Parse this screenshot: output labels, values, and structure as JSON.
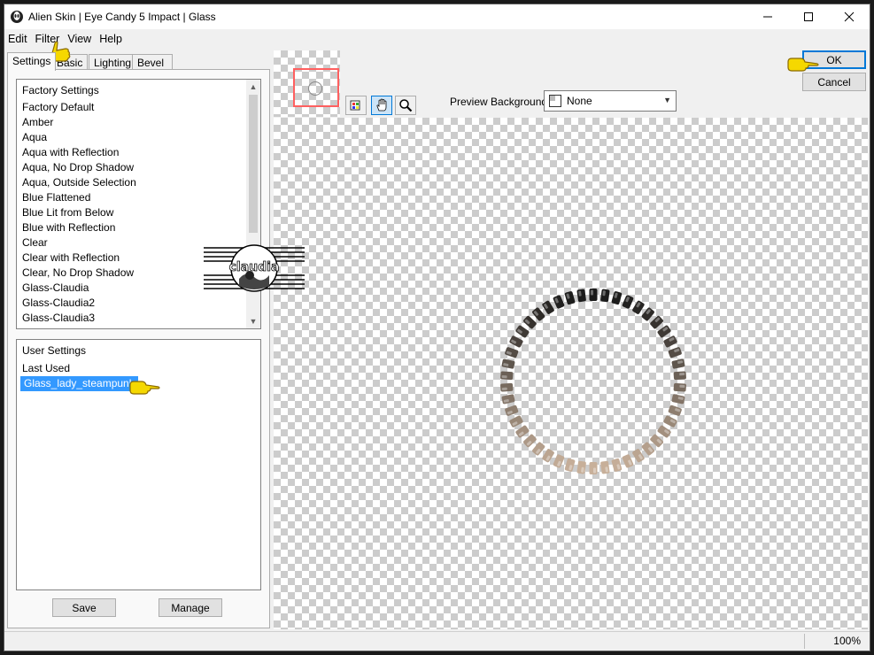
{
  "window": {
    "title": "Alien Skin | Eye Candy 5 Impact | Glass",
    "icons": [
      "app-icon",
      "minimize-icon",
      "maximize-icon",
      "close-icon"
    ]
  },
  "menu": [
    "Edit",
    "Filter",
    "View",
    "Help"
  ],
  "tabs": [
    "Settings",
    "Basic",
    "Lighting",
    "Bevel Profile"
  ],
  "factory_settings": {
    "header": "Factory Settings",
    "items": [
      "Factory Default",
      "Amber",
      "Aqua",
      "Aqua with Reflection",
      "Aqua, No Drop Shadow",
      "Aqua, Outside Selection",
      "Blue Flattened",
      "Blue Lit from Below",
      "Blue with Reflection",
      "Clear",
      "Clear with Reflection",
      "Clear, No Drop Shadow",
      "Glass-Claudia",
      "Glass-Claudia2",
      "Glass-Claudia3"
    ]
  },
  "user_settings": {
    "header": "User Settings",
    "items": [
      "Last Used",
      "Glass_lady_steampunk"
    ],
    "selected": "Glass_lady_steampunk"
  },
  "buttons": {
    "save": "Save",
    "manage": "Manage",
    "ok": "OK",
    "cancel": "Cancel"
  },
  "preview": {
    "background_label": "Preview Background:",
    "background_value": "None"
  },
  "status": {
    "zoom": "100%"
  },
  "watermark": {
    "text": "claudia"
  },
  "colors": {
    "selection": "#3399ff",
    "ring_dark": "#1a1a1a",
    "ring_light": "#c8b09a",
    "pointer": "#f5d800"
  }
}
